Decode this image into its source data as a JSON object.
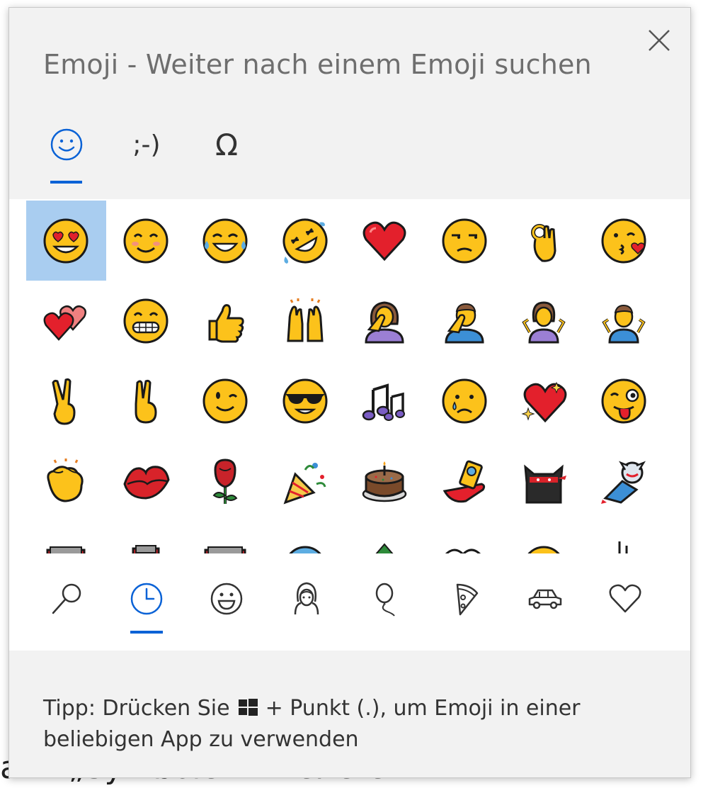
{
  "window": {
    "title": "Emoji - Weiter nach einem Emoji suchen",
    "close_icon": "close-icon"
  },
  "top_tabs": [
    {
      "name": "emoji-tab",
      "glyph": "☺",
      "icon": "smiley-icon",
      "active": true
    },
    {
      "name": "kaomoji-tab",
      "glyph": ";-)",
      "icon": "kaomoji-icon",
      "active": false
    },
    {
      "name": "symbols-tab",
      "glyph": "Ω",
      "icon": "omega-icon",
      "active": false
    }
  ],
  "emoji_rows": [
    [
      "heart-eyes",
      "smiling-face",
      "tears-of-joy",
      "rolling-laughing",
      "red-heart",
      "unamused-face",
      "ok-hand",
      "face-blowing-kiss"
    ],
    [
      "two-hearts",
      "grinning-face",
      "thumbs-up",
      "raising-hands",
      "woman-facepalming",
      "man-facepalming",
      "woman-shrugging",
      "man-shrugging"
    ],
    [
      "victory-hand",
      "crossed-fingers",
      "winking-face",
      "sunglasses-face",
      "musical-notes",
      "crying-face",
      "sparkling-heart",
      "winking-tongue-face"
    ],
    [
      "clapping-hands",
      "kiss-mark",
      "rose",
      "party-popper",
      "birthday-cake",
      "selfie",
      "ninja-cat",
      "astronaut-cat"
    ],
    [
      "partial-1",
      "partial-2",
      "partial-3",
      "partial-4",
      "partial-5",
      "partial-6",
      "partial-7",
      "partial-8"
    ]
  ],
  "selected_emoji": "heart-eyes",
  "bottom_tabs": [
    {
      "name": "search-tab",
      "icon": "search-icon",
      "active": false
    },
    {
      "name": "recent-tab",
      "icon": "clock-icon",
      "active": true
    },
    {
      "name": "smileys-tab",
      "icon": "smiley-face-icon",
      "active": false
    },
    {
      "name": "people-tab",
      "icon": "person-icon",
      "active": false
    },
    {
      "name": "celebration-tab",
      "icon": "balloon-icon",
      "active": false
    },
    {
      "name": "food-tab",
      "icon": "pizza-icon",
      "active": false
    },
    {
      "name": "travel-tab",
      "icon": "car-icon",
      "active": false
    },
    {
      "name": "symbols-heart-tab",
      "icon": "heart-outline-icon",
      "active": false
    }
  ],
  "footer": {
    "tip_prefix": "Tipp: Drücken Sie",
    "tip_suffix": "+ Punkt (.), um Emoji in einer beliebigen App zu verwenden",
    "key_icon": "windows-key-icon"
  },
  "background": {
    "fragment_1": "ann „Symbole“ - Weitere"
  },
  "colors": {
    "accent": "#0a62d6",
    "selected_cell": "#a9cdf0",
    "panel_bg": "#f2f2f2",
    "title_text": "#6e6e6e"
  }
}
